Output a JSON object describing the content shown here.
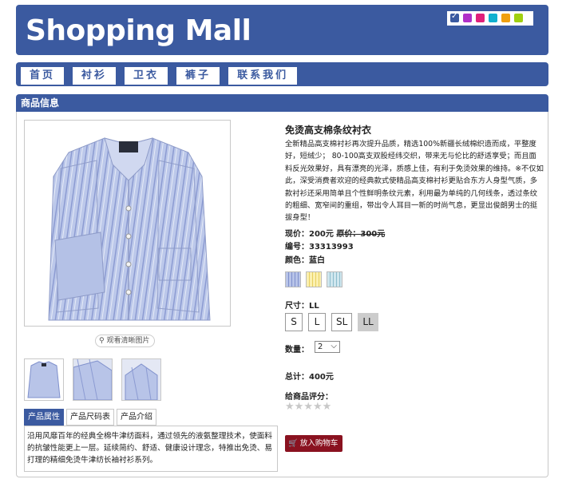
{
  "header": {
    "title": "Shopping Mall",
    "theme_swatches": [
      {
        "color": "#3b5aa0",
        "selected": true
      },
      {
        "color": "#b030c8",
        "selected": false
      },
      {
        "color": "#e0207a",
        "selected": false
      },
      {
        "color": "#10b0d0",
        "selected": false
      },
      {
        "color": "#f0a010",
        "selected": false
      },
      {
        "color": "#a0d010",
        "selected": false
      }
    ]
  },
  "nav": {
    "items": [
      "首页",
      "衬衫",
      "卫衣",
      "裤子",
      "联系我们"
    ]
  },
  "section": {
    "title": "商品信息"
  },
  "gallery": {
    "zoom_label": "观看清晰图片",
    "zoom_icon": "magnifier-icon",
    "thumbnail_count": 3
  },
  "tabs": {
    "items": [
      "产品属性",
      "产品尺码表",
      "产品介绍"
    ],
    "active_index": 0,
    "content": "沿用风靡百年的经典全棉牛津纺面料，通过领先的液氨整理技术，使面料的抗皱性能更上一层。延续简约、舒适、健康设计理念，特推出免烫、易打理的精细免烫牛津纺长袖衬衫系列。"
  },
  "product": {
    "name": "免烫高支棉条纹衬衣",
    "description": "全新精品高支棉衬衫再次提升品质，精选100%新疆长绒棉织造而成，平整度好，短绒少； 80-100高支双股经纬交织，带来无与伦比的舒适享受；而且面料反光效果好，具有漂亮的光泽，质感上佳，有利于免烫效果的维持。※不仅如此，深受消费者欢迎的经典款式使精品高支棉衬衫更贴合东方人身型气质，多款衬衫还采用简单且个性鲜明条纹元素，利用最为单纯的几何线条，透过条纹的粗细、宽窄间的重组，带出令人耳目一新的时尚气息，更显出俊朗男士的挺拔身型！",
    "price_label": "现价：",
    "price": "200元",
    "old_price_label": "原价：",
    "old_price": "300元",
    "sku_label": "编号：",
    "sku": "33313993",
    "color_label": "颜色：",
    "color": "蓝白",
    "color_options": [
      {
        "name": "蓝白",
        "color": "#b8c4e8",
        "stripe": "#7f90cc"
      },
      {
        "name": "黄白",
        "color": "#fbf0b0",
        "stripe": "#e8d060"
      },
      {
        "name": "青白",
        "color": "#cfe6ee",
        "stripe": "#8cbccc"
      }
    ],
    "size_label": "尺寸：",
    "size": "LL",
    "size_options": [
      "S",
      "L",
      "SL",
      "LL"
    ],
    "selected_size_index": 3,
    "qty_label": "数量：",
    "qty": "2",
    "total_label": "总计：",
    "total": "400元",
    "rating_label": "给商品评分：",
    "rating": 0,
    "rating_max": 5,
    "cart_label": "放入购物车",
    "cart_icon": "shopping-cart-icon"
  }
}
